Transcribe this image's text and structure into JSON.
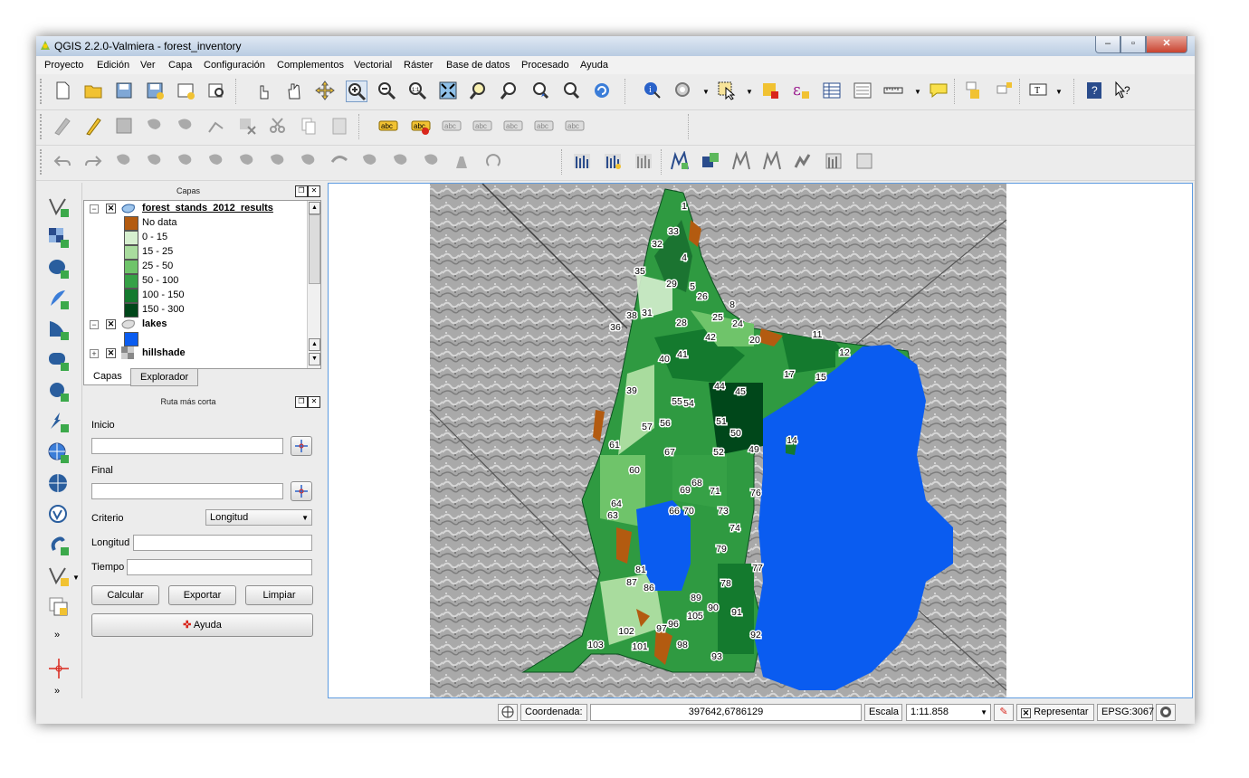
{
  "window": {
    "title": "QGIS 2.2.0-Valmiera - forest_inventory",
    "buttons": {
      "minimize": "–",
      "restore": "▫",
      "close": "✕"
    }
  },
  "menu": [
    "Proyecto",
    "Edición",
    "Ver",
    "Capa",
    "Configuración",
    "Complementos",
    "Vectorial",
    "Ráster",
    "Base de datos",
    "Procesado",
    "Ayuda"
  ],
  "toolbar_icons": {
    "row1": [
      "new-project",
      "open-project",
      "save-project",
      "save-as",
      "print-composer",
      "composer-manager",
      "touch-zoom",
      "pan",
      "pan-to-selection",
      "zoom-in",
      "zoom-out",
      "zoom-native",
      "zoom-full",
      "zoom-to-selection",
      "zoom-to-layer",
      "zoom-last",
      "zoom-next",
      "refresh",
      "identify",
      "action",
      "select",
      "deselect",
      "expression-select",
      "attribute-table",
      "statistics",
      "measure",
      "annotation",
      "label-tool",
      "add-label",
      "text-annotation",
      "help",
      "whats-this"
    ],
    "row2": [
      "digitize",
      "toggle-edit",
      "save-edits",
      "add-feature",
      "move-feature",
      "node-tool",
      "delete-selected",
      "cut-features",
      "copy-features",
      "paste-features",
      "label-abc",
      "label-highlight",
      "label-pin",
      "label-show",
      "label-move",
      "label-rotate",
      "label-change"
    ],
    "row3": [
      "undo",
      "redo",
      "simplify",
      "add-ring",
      "add-part",
      "fill-ring",
      "delete-ring",
      "delete-part",
      "reshape",
      "offset-curve",
      "split-features",
      "split-parts",
      "merge-selected",
      "merge-attributes",
      "rotate-point",
      "raster-tools-1",
      "raster-tools-2",
      "raster-tools-3",
      "vector-tools-1",
      "vector-tools-2",
      "vector-tools-3",
      "vector-tools-4",
      "vector-tools-5",
      "vector-tools-6"
    ]
  },
  "layers_panel": {
    "title": "Capas",
    "layers": [
      {
        "name": "forest_stands_2012_results",
        "checked": true
      },
      {
        "name": "lakes",
        "checked": true
      },
      {
        "name": "hillshade",
        "checked": true
      }
    ],
    "legend": [
      {
        "label": "No data",
        "color": "#b35b10"
      },
      {
        "label": "0 - 15",
        "color": "#d6efcf"
      },
      {
        "label": "15 - 25",
        "color": "#a9dc9e"
      },
      {
        "label": "25 - 50",
        "color": "#6fc46a"
      },
      {
        "label": "50 - 100",
        "color": "#36a146"
      },
      {
        "label": "100 - 150",
        "color": "#147a2e"
      },
      {
        "label": "150 - 300",
        "color": "#00471a"
      }
    ],
    "lake_color": "#0a5cf0",
    "tabs": [
      "Capas",
      "Explorador"
    ]
  },
  "route_panel": {
    "title": "Ruta más corta",
    "start_label": "Inicio",
    "start_value": "",
    "end_label": "Final",
    "end_value": "",
    "criterion_label": "Criterio",
    "criterion_value": "Longitud",
    "length_label": "Longitud",
    "length_value": "",
    "time_label": "Tiempo",
    "time_value": "",
    "buttons": {
      "calc": "Calcular",
      "export": "Exportar",
      "clear": "Limpiar",
      "help": "Ayuda"
    }
  },
  "map": {
    "stand_labels": [
      "1",
      "33",
      "32",
      "4",
      "35",
      "29",
      "5",
      "26",
      "8",
      "38",
      "31",
      "28",
      "25",
      "24",
      "36",
      "42",
      "20",
      "11",
      "12",
      "40",
      "41",
      "17",
      "15",
      "39",
      "44",
      "45",
      "55",
      "54",
      "57",
      "56",
      "51",
      "50",
      "14",
      "61",
      "67",
      "52",
      "49",
      "60",
      "68",
      "69",
      "71",
      "76",
      "64",
      "66",
      "70",
      "73",
      "63",
      "74",
      "79",
      "77",
      "81",
      "87",
      "86",
      "78",
      "89",
      "90",
      "105",
      "91",
      "97",
      "96",
      "102",
      "101",
      "92",
      "98",
      "93",
      "103"
    ]
  },
  "statusbar": {
    "coord_label": "Coordenada:",
    "coord_value": "397642,6786129",
    "scale_label": "Escala",
    "scale_value": "1:11.858",
    "render_label": "Representar",
    "epsg": "EPSG:3067"
  }
}
